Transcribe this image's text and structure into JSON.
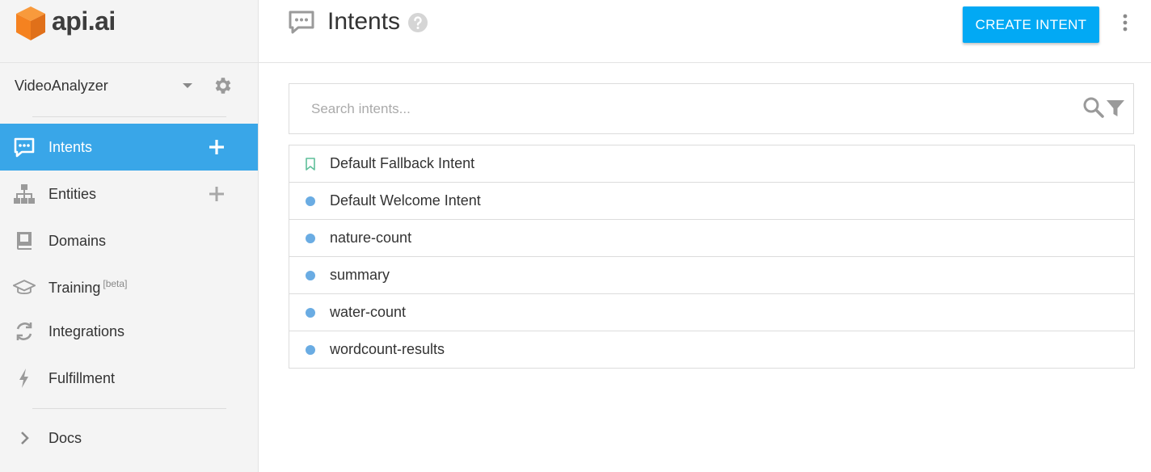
{
  "brand": {
    "logo_text": "api.ai",
    "accent": "#f58220"
  },
  "sidebar": {
    "agent_name": "VideoAnalyzer",
    "items": [
      {
        "label": "Intents",
        "icon": "chat-bubble-icon",
        "active": true,
        "has_add": true
      },
      {
        "label": "Entities",
        "icon": "hierarchy-icon",
        "active": false,
        "has_add": true
      },
      {
        "label": "Domains",
        "icon": "book-icon",
        "active": false,
        "has_add": false
      },
      {
        "label": "Training",
        "sup": "[beta]",
        "icon": "graduation-cap-icon",
        "active": false,
        "has_add": false
      },
      {
        "label": "Integrations",
        "icon": "sync-icon",
        "active": false,
        "has_add": false
      },
      {
        "label": "Fulfillment",
        "icon": "lightning-icon",
        "active": false,
        "has_add": false
      }
    ],
    "docs_label": "Docs",
    "active_color": "#39a6e8"
  },
  "header": {
    "title": "Intents",
    "create_button_label": "CREATE INTENT",
    "button_color": "#02a9f4"
  },
  "search": {
    "placeholder": "Search intents...",
    "value": ""
  },
  "intents": [
    {
      "name": "Default Fallback Intent",
      "marker": "bookmark"
    },
    {
      "name": "Default Welcome Intent",
      "marker": "dot"
    },
    {
      "name": "nature-count",
      "marker": "dot"
    },
    {
      "name": "summary",
      "marker": "dot"
    },
    {
      "name": "water-count",
      "marker": "dot"
    },
    {
      "name": "wordcount-results",
      "marker": "dot"
    }
  ]
}
